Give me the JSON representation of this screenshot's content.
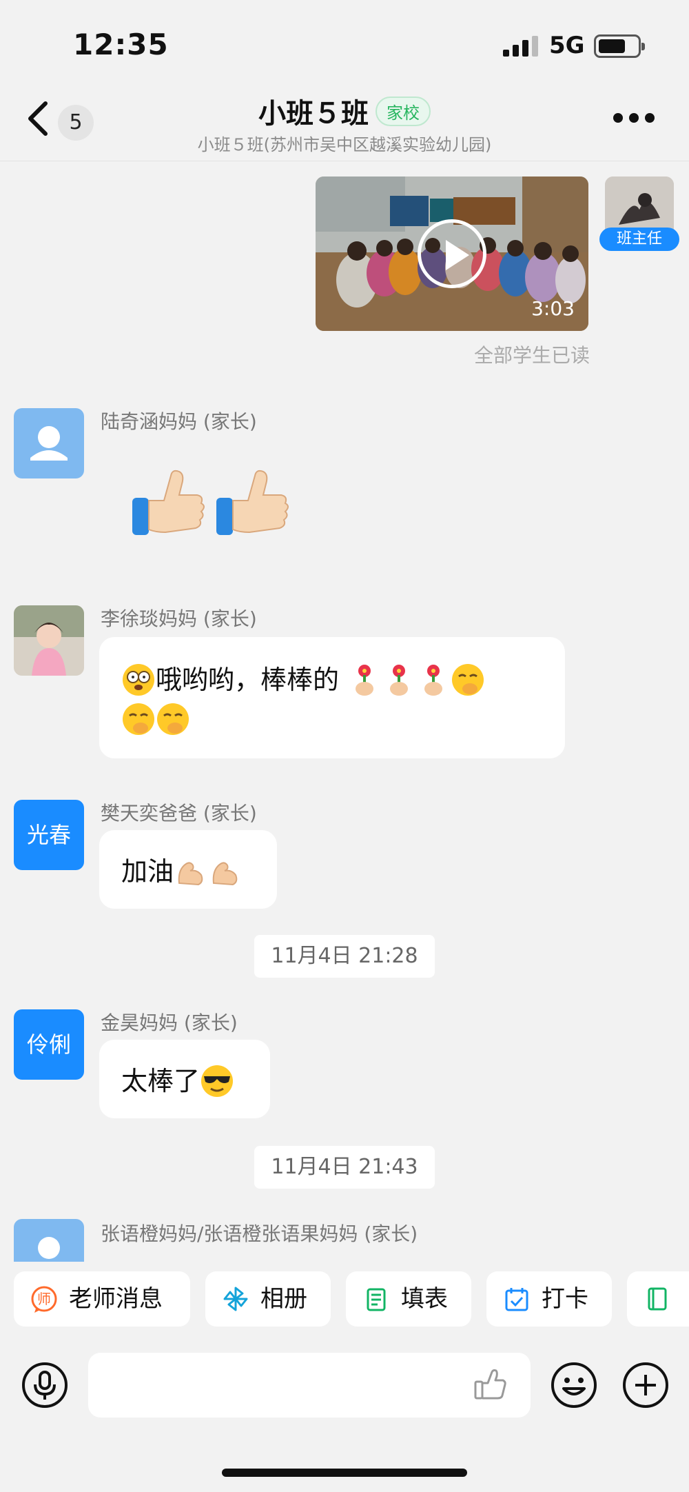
{
  "status_bar": {
    "time": "12:35",
    "network": "5G"
  },
  "header": {
    "back_count": "5",
    "title": "小班５班",
    "tag": "家校",
    "subtitle": "小班５班(苏州市吴中区越溪实验幼儿园)"
  },
  "video_message": {
    "duration": "3:03",
    "read_status": "全部学生已读",
    "teacher_badge": "班主任"
  },
  "messages": [
    {
      "sender": "陆奇涵妈妈 (家长)",
      "avatar_type": "default-person-icon",
      "content_emojis": [
        "thumbs-up",
        "thumbs-up"
      ]
    },
    {
      "sender": "李徐琰妈妈 (家长)",
      "avatar_type": "photo",
      "text_line1": "哦哟哟，棒棒的",
      "text_line2": ""
    },
    {
      "sender": "樊天奕爸爸 (家长)",
      "avatar_text": "光春",
      "text": "加油"
    },
    {
      "sender": "金昊妈妈 (家长)",
      "avatar_text": "伶俐",
      "text": "太棒了"
    },
    {
      "sender": "张语橙妈妈/张语橙张语果妈妈 (家长)",
      "avatar_type": "default-person-icon"
    }
  ],
  "timestamps": [
    "11月4日 21:28",
    "11月4日 21:43"
  ],
  "quick_actions": [
    {
      "label": "老师消息",
      "icon": "teacher-message-icon",
      "color": "#ff6a2b"
    },
    {
      "label": "相册",
      "icon": "album-pinwheel-icon",
      "color": "#14a3d9"
    },
    {
      "label": "填表",
      "icon": "form-icon",
      "color": "#12b464"
    },
    {
      "label": "打卡",
      "icon": "checkin-calendar-icon",
      "color": "#1a8cff"
    },
    {
      "label": "",
      "icon": "notebook-icon",
      "color": "#12b464"
    }
  ],
  "input": {
    "placeholder": ""
  },
  "colors": {
    "accent_blue": "#1a8cff",
    "tag_green": "#26b55e",
    "background": "#f2f2f2"
  }
}
